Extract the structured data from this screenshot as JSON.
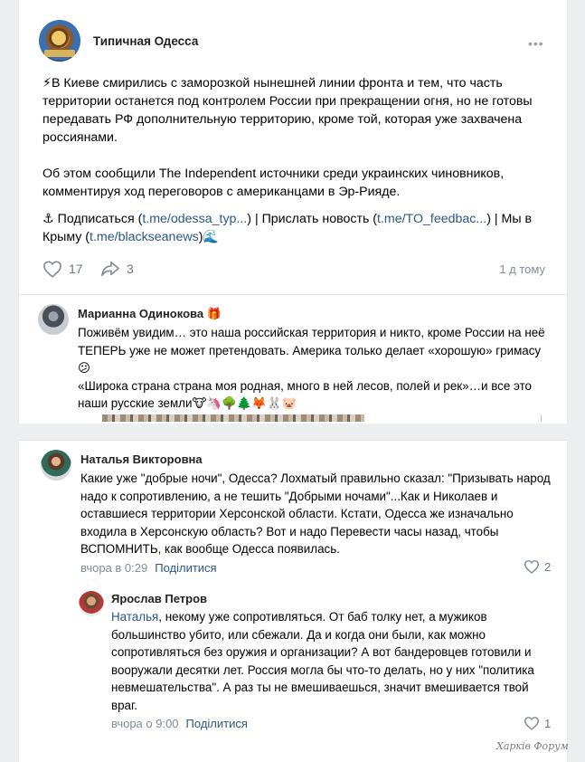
{
  "post": {
    "author": "Типичная Одесса",
    "paragraph1": "⚡В Киеве смирились с заморозкой нынешней линии фронта и тем, что часть территории останется под контролем России при прекращении огня, но не готовы передавать РФ дополнительную территорию, кроме той, которая уже захвачена россиянами.",
    "paragraph2": "Об этом сообщили The Independent источники среди украинских чиновников, комментируя ход переговоров с американцами в Эр-Рияде.",
    "footer": {
      "anchor_icon": "⚓",
      "subscribe_text": " Подписаться (",
      "subscribe_link": "t.me/odessa_typ...",
      "news_text": ") | Прислать новость (",
      "news_link": "t.me/TO_feedbac...",
      "crimea_text": ") | Мы в Крыму (",
      "crimea_link": "t.me/blackseanews",
      "wave_icon": ")🌊"
    },
    "likes": "17",
    "shares": "3",
    "date": "1 д тому"
  },
  "comments": [
    {
      "author": "Марианна Одинокова 🎁",
      "text": "Поживём увидим… это наша российская территория и никто, кроме России на неё ТЕПЕРЬ уже не может претендовать. Америка только делает «хорошую» гримасу😕\n«Широка страна страна моя родная, много в ней лесов, полей и рек»…и все это наши русские земли🐮🦄🌳🌲🦊🐰🐷"
    },
    {
      "author": "Наталья Викторовна",
      "text": "Какие уже \"добрые ночи\", Одесса? Лохматый правильно сказал: \"Призывать народ надо к сопротивлению, а не тешить \"Добрыми ночами\"...Как и Николаев и оставшиеся территории Херсонской области. Кстати, Одесса же изначально входила в Херсонскую область? Вот и надо Перевести часы назад, чтобы ВСПОМНИТЬ, как вообще Одесса появилась.",
      "time": "вчора в 0:29",
      "reply": "Поділитися",
      "likes": "2"
    },
    {
      "author": "Ярослав Петров",
      "mention": "Наталья",
      "text": ", некому уже сопротивляться. От баб толку нет, а мужиков большинство убито, или сбежали. Да и когда они были, как можно сопротивляться без оружия и организации? А вот бандеровцев готовили и вооружали десятки лет. Россия могла бы что-то делать, но у них \"политика невмешательства\". А раз ты не вмешиваешься, значит вмешивается твой враг.",
      "time": "вчора о 9:00",
      "reply": "Поділитися",
      "likes": "1"
    }
  ],
  "watermark": "Харків Форум",
  "icons": {
    "like": "heart-outline-icon",
    "share": "share-arrow-icon",
    "more": "more-dots-icon"
  },
  "colors": {
    "link": "#2a5885",
    "secondary": "#818c99",
    "background": "#edeef0"
  }
}
